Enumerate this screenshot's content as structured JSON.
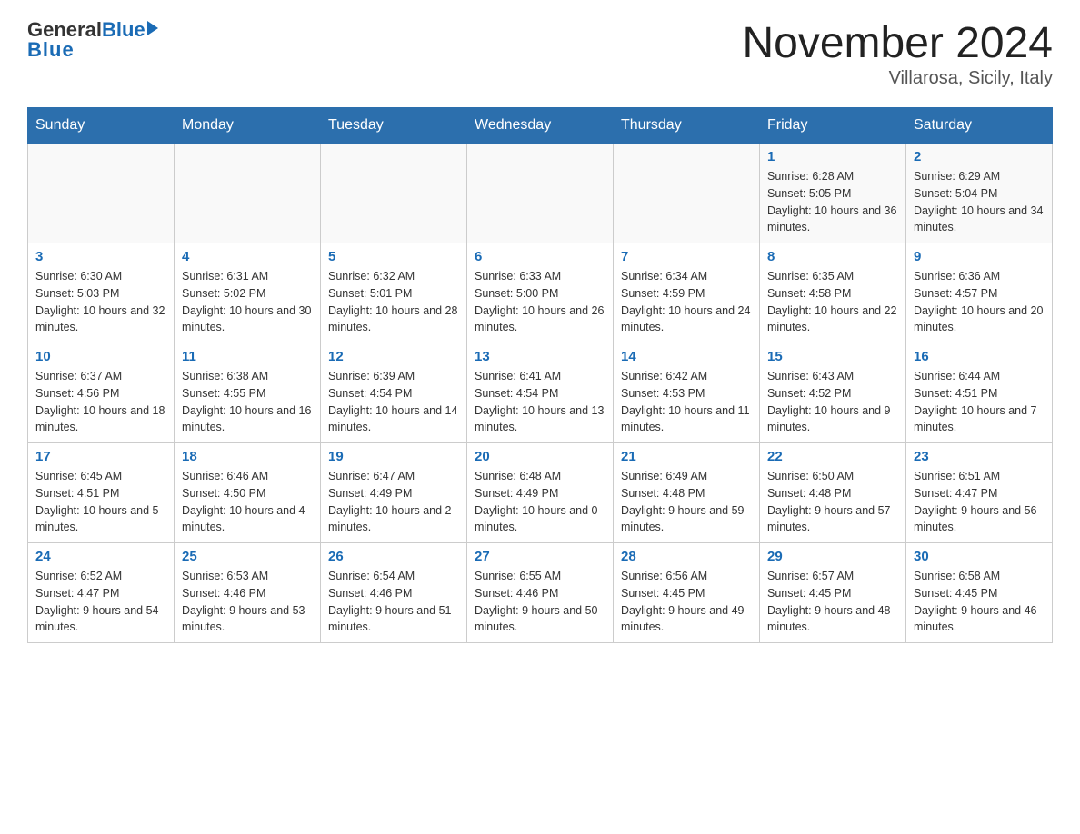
{
  "header": {
    "logo_general": "General",
    "logo_blue": "Blue",
    "month_title": "November 2024",
    "location": "Villarosa, Sicily, Italy"
  },
  "weekdays": [
    "Sunday",
    "Monday",
    "Tuesday",
    "Wednesday",
    "Thursday",
    "Friday",
    "Saturday"
  ],
  "weeks": [
    [
      {
        "day": "",
        "sunrise": "",
        "sunset": "",
        "daylight": ""
      },
      {
        "day": "",
        "sunrise": "",
        "sunset": "",
        "daylight": ""
      },
      {
        "day": "",
        "sunrise": "",
        "sunset": "",
        "daylight": ""
      },
      {
        "day": "",
        "sunrise": "",
        "sunset": "",
        "daylight": ""
      },
      {
        "day": "",
        "sunrise": "",
        "sunset": "",
        "daylight": ""
      },
      {
        "day": "1",
        "sunrise": "Sunrise: 6:28 AM",
        "sunset": "Sunset: 5:05 PM",
        "daylight": "Daylight: 10 hours and 36 minutes."
      },
      {
        "day": "2",
        "sunrise": "Sunrise: 6:29 AM",
        "sunset": "Sunset: 5:04 PM",
        "daylight": "Daylight: 10 hours and 34 minutes."
      }
    ],
    [
      {
        "day": "3",
        "sunrise": "Sunrise: 6:30 AM",
        "sunset": "Sunset: 5:03 PM",
        "daylight": "Daylight: 10 hours and 32 minutes."
      },
      {
        "day": "4",
        "sunrise": "Sunrise: 6:31 AM",
        "sunset": "Sunset: 5:02 PM",
        "daylight": "Daylight: 10 hours and 30 minutes."
      },
      {
        "day": "5",
        "sunrise": "Sunrise: 6:32 AM",
        "sunset": "Sunset: 5:01 PM",
        "daylight": "Daylight: 10 hours and 28 minutes."
      },
      {
        "day": "6",
        "sunrise": "Sunrise: 6:33 AM",
        "sunset": "Sunset: 5:00 PM",
        "daylight": "Daylight: 10 hours and 26 minutes."
      },
      {
        "day": "7",
        "sunrise": "Sunrise: 6:34 AM",
        "sunset": "Sunset: 4:59 PM",
        "daylight": "Daylight: 10 hours and 24 minutes."
      },
      {
        "day": "8",
        "sunrise": "Sunrise: 6:35 AM",
        "sunset": "Sunset: 4:58 PM",
        "daylight": "Daylight: 10 hours and 22 minutes."
      },
      {
        "day": "9",
        "sunrise": "Sunrise: 6:36 AM",
        "sunset": "Sunset: 4:57 PM",
        "daylight": "Daylight: 10 hours and 20 minutes."
      }
    ],
    [
      {
        "day": "10",
        "sunrise": "Sunrise: 6:37 AM",
        "sunset": "Sunset: 4:56 PM",
        "daylight": "Daylight: 10 hours and 18 minutes."
      },
      {
        "day": "11",
        "sunrise": "Sunrise: 6:38 AM",
        "sunset": "Sunset: 4:55 PM",
        "daylight": "Daylight: 10 hours and 16 minutes."
      },
      {
        "day": "12",
        "sunrise": "Sunrise: 6:39 AM",
        "sunset": "Sunset: 4:54 PM",
        "daylight": "Daylight: 10 hours and 14 minutes."
      },
      {
        "day": "13",
        "sunrise": "Sunrise: 6:41 AM",
        "sunset": "Sunset: 4:54 PM",
        "daylight": "Daylight: 10 hours and 13 minutes."
      },
      {
        "day": "14",
        "sunrise": "Sunrise: 6:42 AM",
        "sunset": "Sunset: 4:53 PM",
        "daylight": "Daylight: 10 hours and 11 minutes."
      },
      {
        "day": "15",
        "sunrise": "Sunrise: 6:43 AM",
        "sunset": "Sunset: 4:52 PM",
        "daylight": "Daylight: 10 hours and 9 minutes."
      },
      {
        "day": "16",
        "sunrise": "Sunrise: 6:44 AM",
        "sunset": "Sunset: 4:51 PM",
        "daylight": "Daylight: 10 hours and 7 minutes."
      }
    ],
    [
      {
        "day": "17",
        "sunrise": "Sunrise: 6:45 AM",
        "sunset": "Sunset: 4:51 PM",
        "daylight": "Daylight: 10 hours and 5 minutes."
      },
      {
        "day": "18",
        "sunrise": "Sunrise: 6:46 AM",
        "sunset": "Sunset: 4:50 PM",
        "daylight": "Daylight: 10 hours and 4 minutes."
      },
      {
        "day": "19",
        "sunrise": "Sunrise: 6:47 AM",
        "sunset": "Sunset: 4:49 PM",
        "daylight": "Daylight: 10 hours and 2 minutes."
      },
      {
        "day": "20",
        "sunrise": "Sunrise: 6:48 AM",
        "sunset": "Sunset: 4:49 PM",
        "daylight": "Daylight: 10 hours and 0 minutes."
      },
      {
        "day": "21",
        "sunrise": "Sunrise: 6:49 AM",
        "sunset": "Sunset: 4:48 PM",
        "daylight": "Daylight: 9 hours and 59 minutes."
      },
      {
        "day": "22",
        "sunrise": "Sunrise: 6:50 AM",
        "sunset": "Sunset: 4:48 PM",
        "daylight": "Daylight: 9 hours and 57 minutes."
      },
      {
        "day": "23",
        "sunrise": "Sunrise: 6:51 AM",
        "sunset": "Sunset: 4:47 PM",
        "daylight": "Daylight: 9 hours and 56 minutes."
      }
    ],
    [
      {
        "day": "24",
        "sunrise": "Sunrise: 6:52 AM",
        "sunset": "Sunset: 4:47 PM",
        "daylight": "Daylight: 9 hours and 54 minutes."
      },
      {
        "day": "25",
        "sunrise": "Sunrise: 6:53 AM",
        "sunset": "Sunset: 4:46 PM",
        "daylight": "Daylight: 9 hours and 53 minutes."
      },
      {
        "day": "26",
        "sunrise": "Sunrise: 6:54 AM",
        "sunset": "Sunset: 4:46 PM",
        "daylight": "Daylight: 9 hours and 51 minutes."
      },
      {
        "day": "27",
        "sunrise": "Sunrise: 6:55 AM",
        "sunset": "Sunset: 4:46 PM",
        "daylight": "Daylight: 9 hours and 50 minutes."
      },
      {
        "day": "28",
        "sunrise": "Sunrise: 6:56 AM",
        "sunset": "Sunset: 4:45 PM",
        "daylight": "Daylight: 9 hours and 49 minutes."
      },
      {
        "day": "29",
        "sunrise": "Sunrise: 6:57 AM",
        "sunset": "Sunset: 4:45 PM",
        "daylight": "Daylight: 9 hours and 48 minutes."
      },
      {
        "day": "30",
        "sunrise": "Sunrise: 6:58 AM",
        "sunset": "Sunset: 4:45 PM",
        "daylight": "Daylight: 9 hours and 46 minutes."
      }
    ]
  ]
}
